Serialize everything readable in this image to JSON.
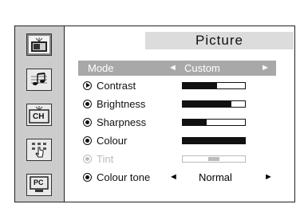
{
  "menu": {
    "title": "Picture",
    "mode": {
      "label": "Mode",
      "value": "Custom",
      "left_arrow": "◄",
      "right_arrow": "►"
    },
    "items": [
      {
        "label": "Contrast",
        "level": 0.55,
        "active": true
      },
      {
        "label": "Brightness",
        "level": 0.78
      },
      {
        "label": "Sharpness",
        "level": 0.38
      },
      {
        "label": "Colour",
        "level": 1.0
      },
      {
        "label": "Tint",
        "level": 0.5,
        "disabled": true
      }
    ],
    "colour_tone": {
      "label": "Colour tone",
      "value": "Normal",
      "left_arrow": "◄",
      "right_arrow": "►"
    }
  },
  "sidebar": {
    "icons": [
      {
        "name": "picture-icon",
        "active": true
      },
      {
        "name": "sound-icon"
      },
      {
        "name": "channel-icon",
        "text": "CH"
      },
      {
        "name": "setup-icon"
      },
      {
        "name": "pc-icon",
        "text": "PC"
      }
    ]
  }
}
